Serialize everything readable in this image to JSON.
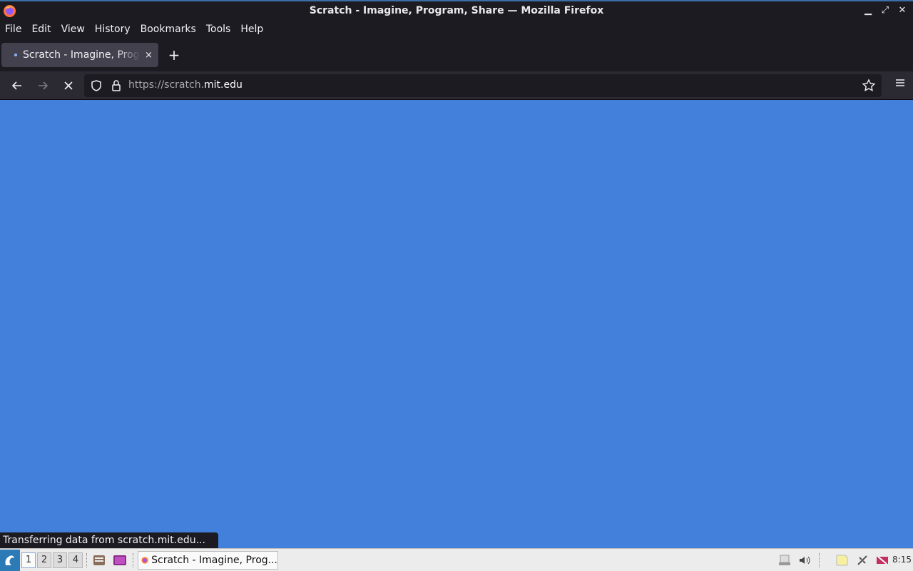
{
  "window": {
    "title": "Scratch - Imagine, Program, Share — Mozilla Firefox"
  },
  "menu": {
    "file": "File",
    "edit": "Edit",
    "view": "View",
    "history": "History",
    "bookmarks": "Bookmarks",
    "tools": "Tools",
    "help": "Help"
  },
  "tab": {
    "title": "Scratch - Imagine, Program, Share",
    "close": "×"
  },
  "newtab": "+",
  "urlbar": {
    "url_prefix": "https://scratch.",
    "url_domain": "mit.edu"
  },
  "status": "Transferring data from scratch.mit.edu...",
  "taskbar": {
    "workspaces": [
      "1",
      "2",
      "3",
      "4"
    ],
    "active_workspace": "1",
    "task_label": "Scratch - Imagine, Prog...",
    "clock": "8:15"
  },
  "colors": {
    "content_bg": "#4280db",
    "chrome_bg": "#1c1b22"
  }
}
